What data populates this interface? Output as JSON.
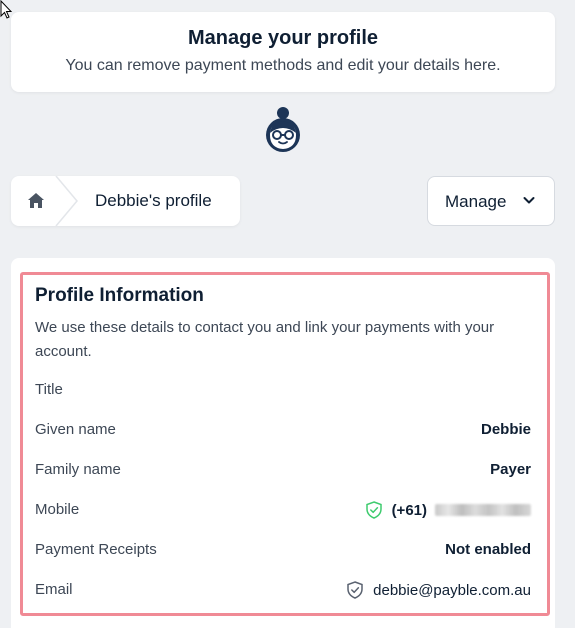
{
  "header": {
    "title": "Manage your profile",
    "subtitle": "You can remove payment methods and edit your details here."
  },
  "breadcrumb": {
    "home_icon": "home-icon",
    "current": "Debbie's profile"
  },
  "manage_button": {
    "label": "Manage",
    "icon": "chevron-down-icon"
  },
  "profile": {
    "title": "Profile Information",
    "description": "We use these details to contact you and link your payments with your account.",
    "rows": [
      {
        "label": "Title",
        "value": ""
      },
      {
        "label": "Given name",
        "value": "Debbie"
      },
      {
        "label": "Family name",
        "value": "Payer"
      },
      {
        "label": "Mobile",
        "value": "(+61)",
        "verified": true
      },
      {
        "label": "Payment Receipts",
        "value": "Not enabled"
      },
      {
        "label": "Email",
        "value": "debbie@payble.com.au",
        "verified": false
      }
    ]
  },
  "colors": {
    "background": "#eef0f3",
    "highlight_border": "#f08a95",
    "verified_green": "#3ecb6e",
    "navy": "#1d3557"
  }
}
